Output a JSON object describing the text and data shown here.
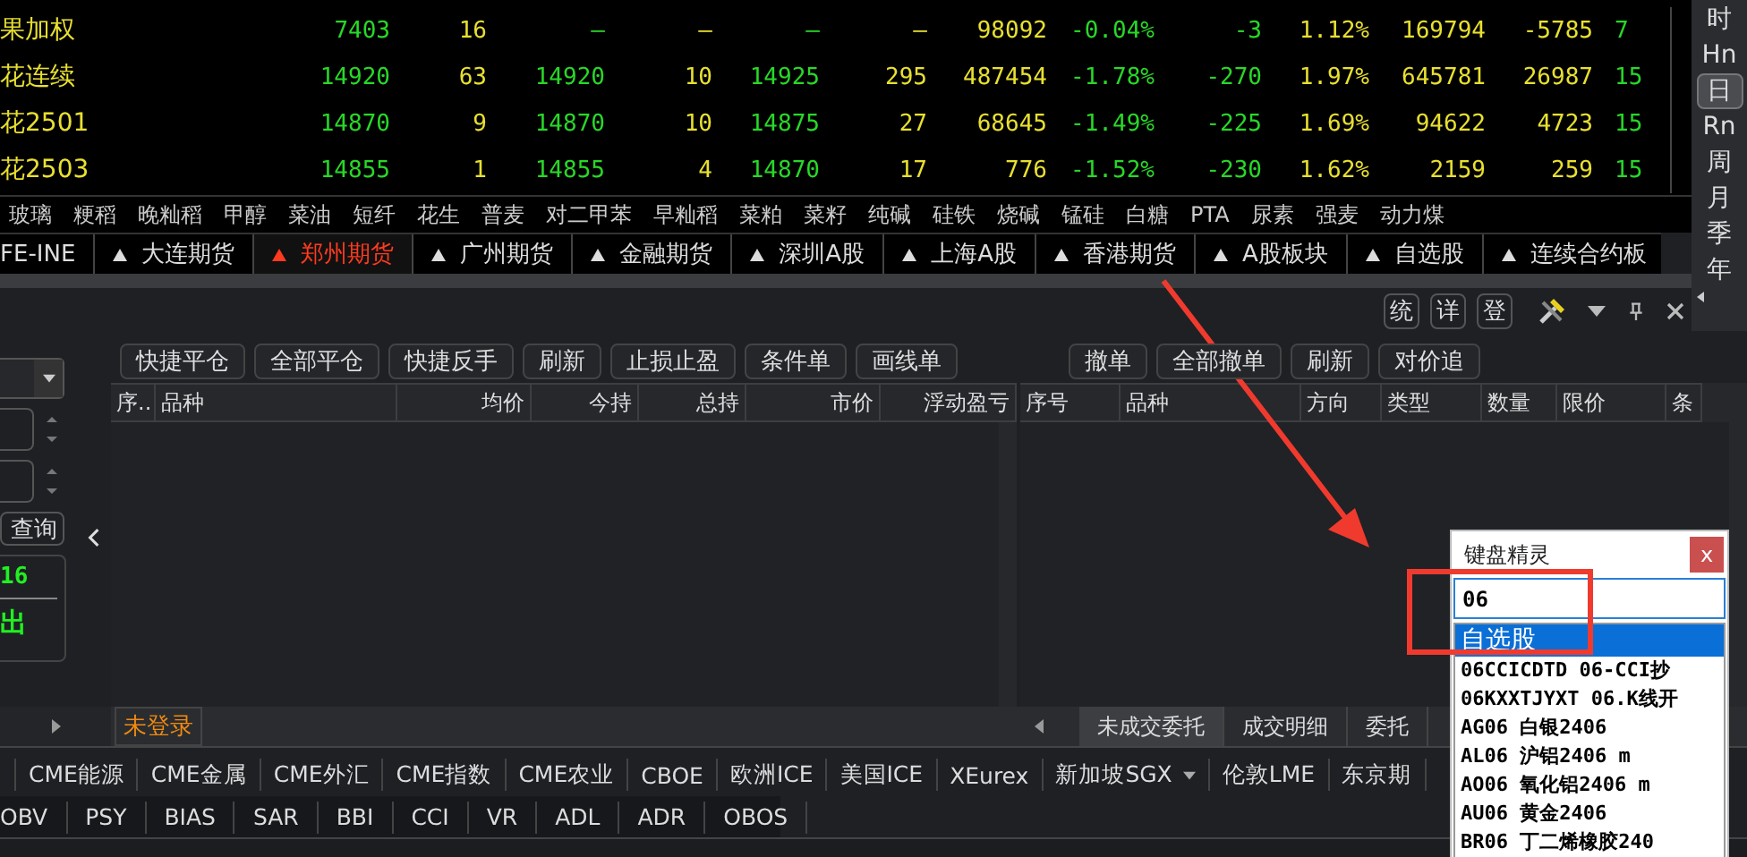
{
  "quotes": {
    "columns": [
      {
        "kind": "name"
      },
      {
        "kind": "price"
      },
      {
        "kind": "amount"
      },
      {
        "kind": "price"
      },
      {
        "kind": "amount"
      },
      {
        "kind": "price"
      },
      {
        "kind": "amount"
      },
      {
        "kind": "amount"
      },
      {
        "kind": "price"
      },
      {
        "kind": "price"
      },
      {
        "kind": "amount"
      },
      {
        "kind": "amount"
      },
      {
        "kind": "amount"
      },
      {
        "kind": "price"
      }
    ],
    "rows": [
      [
        "果加权",
        "7403",
        "16",
        "—",
        "—",
        "—",
        "—",
        "98092",
        "-0.04%",
        "-3",
        "1.12%",
        "169794",
        "-5785",
        "7"
      ],
      [
        "花连续",
        "14920",
        "63",
        "14920",
        "10",
        "14925",
        "295",
        "487454",
        "-1.78%",
        "-270",
        "1.97%",
        "645781",
        "26987",
        "15"
      ],
      [
        "花2501",
        "14870",
        "9",
        "14870",
        "10",
        "14875",
        "27",
        "68645",
        "-1.49%",
        "-225",
        "1.69%",
        "94622",
        "4723",
        "15"
      ],
      [
        "花2503",
        "14855",
        "1",
        "14855",
        "4",
        "14870",
        "17",
        "776",
        "-1.52%",
        "-230",
        "1.62%",
        "2159",
        "259",
        "15"
      ]
    ]
  },
  "categories": [
    "玻璃",
    "粳稻",
    "晚籼稻",
    "甲醇",
    "菜油",
    "短纤",
    "花生",
    "普麦",
    "对二甲苯",
    "早籼稻",
    "菜粕",
    "菜籽",
    "纯碱",
    "硅铁",
    "烧碱",
    "锰硅",
    "白糖",
    "PTA",
    "尿素",
    "强麦",
    "动力煤"
  ],
  "market_tabs": [
    {
      "label": "FE-INE",
      "selected": false
    },
    {
      "label": "大连期货",
      "selected": false
    },
    {
      "label": "郑州期货",
      "selected": true
    },
    {
      "label": "广州期货",
      "selected": false
    },
    {
      "label": "金融期货",
      "selected": false
    },
    {
      "label": "深圳A股",
      "selected": false
    },
    {
      "label": "上海A股",
      "selected": false
    },
    {
      "label": "香港期货",
      "selected": false
    },
    {
      "label": "A股板块",
      "selected": false
    },
    {
      "label": "自选股",
      "selected": false
    },
    {
      "label": "连续合约板",
      "selected": false
    }
  ],
  "periods": [
    {
      "label": "时",
      "selected": false
    },
    {
      "label": "Hn",
      "selected": false
    },
    {
      "label": "日",
      "selected": true
    },
    {
      "label": "Rn",
      "selected": false
    },
    {
      "label": "周",
      "selected": false
    },
    {
      "label": "月",
      "selected": false
    },
    {
      "label": "季",
      "selected": false
    },
    {
      "label": "年",
      "selected": false
    }
  ],
  "panel_buttons": [
    "统",
    "详",
    "登"
  ],
  "left_panel": {
    "query_button": "查询",
    "count": "16",
    "order_label": "出"
  },
  "positions": {
    "buttons": [
      "快捷平仓",
      "全部平仓",
      "快捷反手",
      "刷新",
      "止损止盈",
      "条件单",
      "画线单"
    ],
    "columns": [
      "序..",
      "品种",
      "均价",
      "今持",
      "总持",
      "市价",
      "浮动盈亏"
    ]
  },
  "orders": {
    "buttons": [
      "撤单",
      "全部撤单",
      "刷新",
      "对价追"
    ],
    "columns": [
      "序号",
      "品种",
      "方向",
      "类型",
      "数量",
      "限价",
      "条"
    ]
  },
  "account_tab": "未登录",
  "order_tabs": [
    {
      "label": "未成交委托",
      "selected": true
    },
    {
      "label": "成交明细",
      "selected": false
    },
    {
      "label": "委托",
      "selected": false
    }
  ],
  "exchanges": [
    {
      "label": "CME能源",
      "has_menu": false
    },
    {
      "label": "CME金属",
      "has_menu": false
    },
    {
      "label": "CME外汇",
      "has_menu": false
    },
    {
      "label": "CME指数",
      "has_menu": false
    },
    {
      "label": "CME农业",
      "has_menu": false
    },
    {
      "label": "CBOE",
      "has_menu": false
    },
    {
      "label": "欧洲ICE",
      "has_menu": false
    },
    {
      "label": "美国ICE",
      "has_menu": false
    },
    {
      "label": "XEurex",
      "has_menu": false
    },
    {
      "label": "新加坡SGX",
      "has_menu": true
    },
    {
      "label": "伦敦LME",
      "has_menu": false
    },
    {
      "label": "东京期",
      "has_menu": false
    }
  ],
  "indicators": [
    "OBV",
    "PSY",
    "BIAS",
    "SAR",
    "BBI",
    "CCI",
    "VR",
    "ADL",
    "ADR",
    "OBOS"
  ],
  "keyboard_wizard": {
    "title": "键盘精灵",
    "close": "x",
    "value": "06",
    "items": [
      {
        "text": "自选股",
        "selected": true
      },
      {
        "text": "06CCICDTD 06-CCI抄",
        "selected": false
      },
      {
        "text": "06KXXTJYXT 06.K线开",
        "selected": false
      },
      {
        "text": "AG06 白银2406",
        "selected": false
      },
      {
        "text": "AL06 沪铝2406 m",
        "selected": false
      },
      {
        "text": "AO06 氧化铝2406 m",
        "selected": false
      },
      {
        "text": "AU06 黄金2406",
        "selected": false
      },
      {
        "text": "BR06 丁二烯橡胶240",
        "selected": false
      }
    ]
  }
}
